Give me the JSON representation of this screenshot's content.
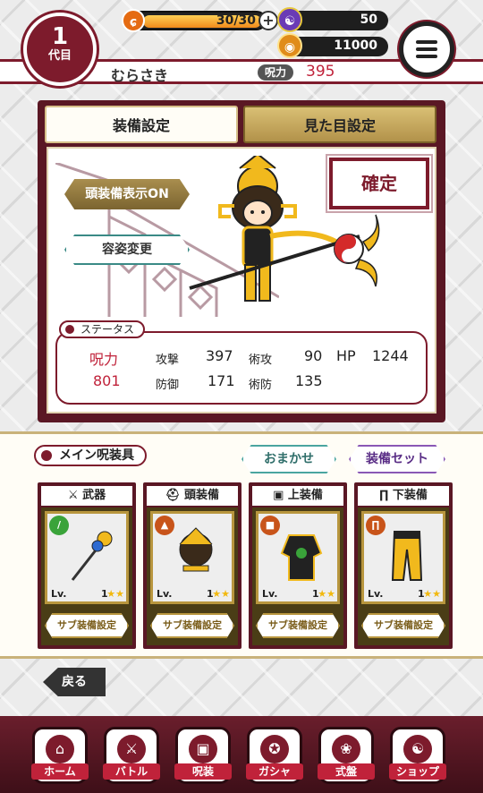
{
  "header": {
    "generation_number": "1",
    "generation_label": "代目",
    "player_name": "むらさき",
    "power_label": "呪力",
    "power_value": "395",
    "stamina_text": "30/30",
    "stamina_fraction": 1.0,
    "plus_label": "+",
    "magatama_value": "50",
    "gold_value": "11000",
    "icons": {
      "stamina": "flame-icon",
      "magatama": "magatama-icon",
      "gold": "coin-bag-icon",
      "menu": "hamburger-icon"
    }
  },
  "tabs": {
    "equip": "装備設定",
    "look": "見た目設定"
  },
  "stage": {
    "headgear_button": "頭装備表示ON",
    "appearance_button": "容姿変更",
    "confirm_button": "確定"
  },
  "status": {
    "tag": "ステータス",
    "power_label": "呪力",
    "power_value": "801",
    "attack_label": "攻撃",
    "attack_value": "397",
    "magic_attack_label": "術攻",
    "magic_attack_value": "90",
    "hp_label": "HP",
    "hp_value": "1244",
    "defense_label": "防御",
    "defense_value": "171",
    "magic_defense_label": "術防",
    "magic_defense_value": "135"
  },
  "equipment": {
    "main_tag": "メイン呪装具",
    "auto_button": "おまかせ",
    "set_button": "装備セット",
    "slots": [
      {
        "label": "武器",
        "lv_label": "Lv.",
        "lv": "1",
        "sub_button": "サブ装備設定",
        "icon": "sword-icon",
        "type_color": "#3aa33a"
      },
      {
        "label": "頭装備",
        "lv_label": "Lv.",
        "lv": "1",
        "sub_button": "サブ装備設定",
        "icon": "helmet-icon",
        "type_color": "#c8541a"
      },
      {
        "label": "上装備",
        "lv_label": "Lv.",
        "lv": "1",
        "sub_button": "サブ装備設定",
        "icon": "jacket-icon",
        "type_color": "#c8541a"
      },
      {
        "label": "下装備",
        "lv_label": "Lv.",
        "lv": "1",
        "sub_button": "サブ装備設定",
        "icon": "pants-icon",
        "type_color": "#c8541a"
      }
    ]
  },
  "back_button": "戻る",
  "nav": [
    {
      "label": "ホーム",
      "icon": "home-icon"
    },
    {
      "label": "バトル",
      "icon": "battle-icon"
    },
    {
      "label": "呪装",
      "icon": "armor-icon"
    },
    {
      "label": "ガシャ",
      "icon": "gacha-icon"
    },
    {
      "label": "式盤",
      "icon": "board-icon"
    },
    {
      "label": "ショップ",
      "icon": "shop-icon"
    }
  ],
  "colors": {
    "maroon": "#7d1b2c",
    "gold": "#b8963e",
    "status_red": "#c0223a",
    "teal": "#4aa5a0",
    "purple": "#8a58b5"
  }
}
